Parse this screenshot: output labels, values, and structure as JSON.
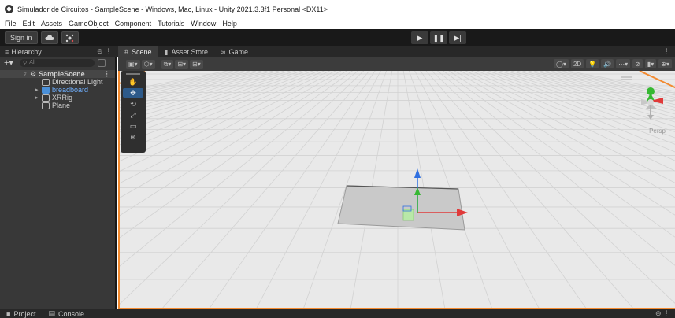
{
  "window": {
    "title": "Simulador de Circuitos - SampleScene - Windows, Mac, Linux - Unity 2021.3.3f1 Personal <DX11>"
  },
  "menu": {
    "items": [
      "File",
      "Edit",
      "Assets",
      "GameObject",
      "Component",
      "Tutorials",
      "Window",
      "Help"
    ]
  },
  "toolbar": {
    "signin_label": "Sign in",
    "cloud_icon": "cloud-icon",
    "collab_icon": "collab-icon",
    "play_icon": "▶",
    "pause_icon": "❚❚",
    "step_icon": "▶|"
  },
  "hierarchy": {
    "tab_label": "Hierarchy",
    "tab_icons": "⊖ ⋮",
    "add_label": "+▾",
    "search_placeholder": "All",
    "rows": [
      {
        "label": "SampleScene",
        "indent": 0
      },
      {
        "label": "Directional Light",
        "indent": 1
      },
      {
        "label": "breadboard",
        "indent": 1
      },
      {
        "label": "XRRig",
        "indent": 1
      },
      {
        "label": "Plane",
        "indent": 1
      }
    ]
  },
  "scene_tabs": {
    "scene_label": "Scene",
    "asset_store_label": "Asset Store",
    "game_label": "Game",
    "more": "⋮"
  },
  "scene_toolbar": {
    "left": [
      "▣▾",
      "⬡▾",
      "⧉▾",
      "⊞▾",
      "⊟▾"
    ],
    "right": [
      "◯▾",
      "2D",
      "💡",
      "🔊",
      "⋯▾",
      "⊘",
      "▮▾",
      "⊕▾"
    ]
  },
  "tool_palette": {
    "tools": [
      "✋",
      "✥",
      "⟲",
      "⤢",
      "▭",
      "⊛"
    ],
    "active_index": 1
  },
  "viewport": {
    "persp_label": "Persp"
  },
  "bottom_tabs": {
    "project_label": "Project",
    "console_label": "Console",
    "more": "⊖ ⋮"
  },
  "colors": {
    "accent_orange": "#f28a30",
    "toolbar_bg": "#191919",
    "panel_bg": "#383838",
    "grid_bg": "#e8e8e8",
    "axis_x": "#e03a3a",
    "axis_y": "#36b832",
    "axis_z": "#2f6fe0"
  }
}
